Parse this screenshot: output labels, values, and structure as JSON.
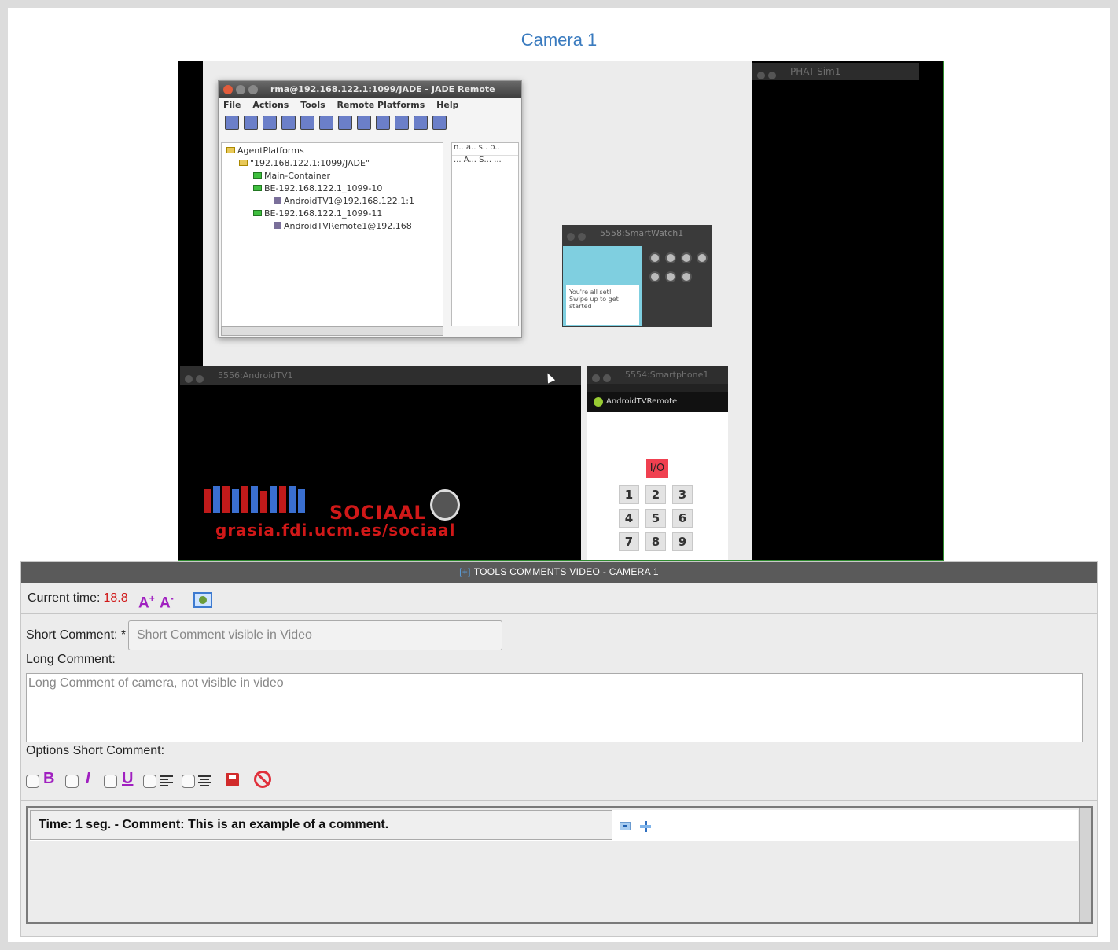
{
  "page_title": "Camera 1",
  "video": {
    "desktop": {
      "jade_window": {
        "title": "rma@192.168.122.1:1099/JADE - JADE Remote",
        "menu": [
          "File",
          "Actions",
          "Tools",
          "Remote Platforms",
          "Help"
        ],
        "tree": [
          {
            "label": "AgentPlatforms",
            "kind": "folder"
          },
          {
            "label": "\"192.168.122.1:1099/JADE\"",
            "kind": "folder"
          },
          {
            "label": "Main-Container",
            "kind": "container"
          },
          {
            "label": "BE-192.168.122.1_1099-10",
            "kind": "container"
          },
          {
            "label": "AndroidTV1@192.168.122.1:1",
            "kind": "agent"
          },
          {
            "label": "BE-192.168.122.1_1099-11",
            "kind": "container"
          },
          {
            "label": "AndroidTVRemote1@192.168",
            "kind": "agent"
          }
        ],
        "grid_headers": [
          "n..",
          "a..",
          "s..",
          "o.."
        ],
        "grid_row": [
          "...",
          "A...",
          "S...",
          "..."
        ]
      },
      "phat_title": "PHAT-Sim1",
      "smartwatch": {
        "title": "5558:SmartWatch1",
        "card_text": "You're all set!",
        "card_sub": "Swipe up to get started"
      },
      "android_tv": {
        "title": "5556:AndroidTV1",
        "logo_text": "SOCIAAL",
        "url_text": "grasia.fdi.ucm.es/sociaal"
      },
      "smartphone": {
        "title": "5554:Smartphone1",
        "app_title": "AndroidTVRemote",
        "power_label": "I/O",
        "keys": [
          "1",
          "2",
          "3",
          "4",
          "5",
          "6",
          "7",
          "8",
          "9"
        ]
      }
    }
  },
  "tools": {
    "header_plus": "[+]",
    "header_label": "TOOLS COMMENTS VIDEO - CAMERA 1",
    "current_time_label": "Current time:",
    "current_time_value": "18.8",
    "font_increase": "A",
    "font_decrease": "A"
  },
  "form": {
    "short_label": "Short Comment: *",
    "short_placeholder": "Short Comment visible in Video",
    "long_label": "Long Comment:",
    "long_placeholder": "Long Comment of camera, not visible in video",
    "options_label": "Options Short Comment:",
    "option_bold": "B",
    "option_italic": "I",
    "option_underline": "U"
  },
  "comments": [
    {
      "text": "Time: 1 seg. - Comment: This is an example of a comment."
    }
  ],
  "colors": {
    "title": "#3a7bbf",
    "time_value": "#d01818",
    "option_glyph": "#a020c0",
    "header_bg": "#5a5a5a"
  }
}
